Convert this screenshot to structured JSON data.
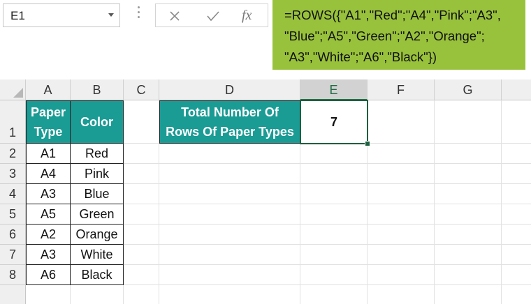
{
  "name_box": {
    "value": "E1"
  },
  "formula_bar": {
    "fx_label": "fx",
    "lines": [
      "=ROWS({\"A1\",\"Red\";\"A4\",\"Pink\";\"A3\",",
      "\"Blue\";\"A5\",\"Green\";\"A2\",\"Orange\";",
      "\"A3\",\"White\";\"A6\",\"Black\"})"
    ],
    "highlight_color": "#99c23c"
  },
  "columns": [
    "A",
    "B",
    "C",
    "D",
    "E",
    "F",
    "G"
  ],
  "rows": [
    "1",
    "2",
    "3",
    "4",
    "5",
    "6",
    "7",
    "8"
  ],
  "selected_column": "E",
  "table": {
    "headers": {
      "paper_type_line1": "Paper",
      "paper_type_line2": "Type",
      "color": "Color"
    },
    "rows": [
      {
        "paper": "A1",
        "color": "Red"
      },
      {
        "paper": "A4",
        "color": "Pink"
      },
      {
        "paper": "A3",
        "color": "Blue"
      },
      {
        "paper": "A5",
        "color": "Green"
      },
      {
        "paper": "A2",
        "color": "Orange"
      },
      {
        "paper": "A3",
        "color": "White"
      },
      {
        "paper": "A6",
        "color": "Black"
      }
    ],
    "header_color": "#1a9b94"
  },
  "result": {
    "label_line1": "Total Number Of",
    "label_line2": "Rows Of Paper Types",
    "value": "7"
  }
}
